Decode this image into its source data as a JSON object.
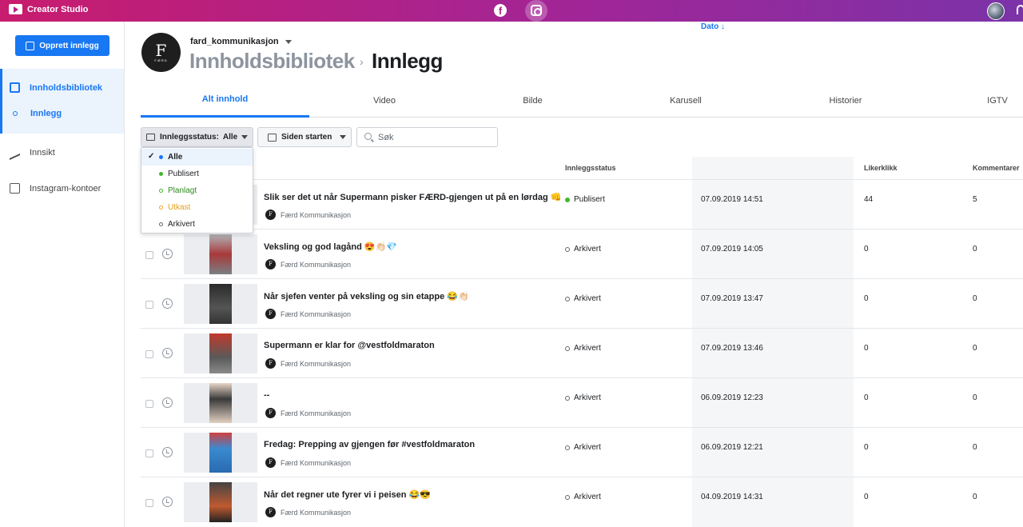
{
  "app": {
    "title": "Creator Studio"
  },
  "sidebar": {
    "create_button": "Opprett innlegg",
    "items": [
      {
        "label": "Innholdsbibliotek"
      },
      {
        "label": "Innlegg"
      },
      {
        "label": "Innsikt"
      },
      {
        "label": "Instagram-kontoer"
      }
    ]
  },
  "header": {
    "account": "fard_kommunikasjon",
    "breadcrumb": "Innholdsbibliotek",
    "separator": "›",
    "page_title": "Innlegg",
    "avatar_letter": "F",
    "avatar_text": "FÆRD"
  },
  "tabs": [
    "Alt innhold",
    "Video",
    "Bilde",
    "Karusell",
    "Historier",
    "IGTV"
  ],
  "filters": {
    "status_label": "Innleggsstatus:",
    "status_value": "Alle",
    "date_label": "Siden starten",
    "search_placeholder": "Søk",
    "options": [
      {
        "label": "Alle",
        "color": "#1877f2"
      },
      {
        "label": "Publisert",
        "color": "#42b72a"
      },
      {
        "label": "Planlagt",
        "color": "#42b72a"
      },
      {
        "label": "Utkast",
        "color": "#f5a623"
      },
      {
        "label": "Arkivert",
        "color": "#606770"
      }
    ],
    "checkmark": "✓"
  },
  "table": {
    "headers": {
      "status": "Innleggsstatus",
      "date": "Dato ↓",
      "likes": "Likerklikk",
      "comments": "Kommentarer"
    },
    "author": "Færd Kommunikasjon",
    "author_initial": "F",
    "rows": [
      {
        "title": "Slik ser det ut når Supermann pisker FÆRD-gjengen ut på en lørdag 👊",
        "status": "Publisert",
        "date": "07.09.2019 14:51",
        "likes": "44",
        "comments": "5"
      },
      {
        "title": "Veksling og god lagånd 😍👏🏻💎",
        "status": "Arkivert",
        "date": "07.09.2019 14:05",
        "likes": "0",
        "comments": "0"
      },
      {
        "title": "Når sjefen venter på veksling og sin etappe 😂👏🏻",
        "status": "Arkivert",
        "date": "07.09.2019 13:47",
        "likes": "0",
        "comments": "0"
      },
      {
        "title": "Supermann er klar for @vestfoldmaraton",
        "status": "Arkivert",
        "date": "07.09.2019 13:46",
        "likes": "0",
        "comments": "0"
      },
      {
        "title": "--",
        "status": "Arkivert",
        "date": "06.09.2019 12:23",
        "likes": "0",
        "comments": "0"
      },
      {
        "title": "Fredag: Prepping av gjengen før #vestfoldmaraton",
        "status": "Arkivert",
        "date": "06.09.2019 12:21",
        "likes": "0",
        "comments": "0"
      },
      {
        "title": "Når det regner ute fyrer vi i peisen 😂😎",
        "status": "Arkivert",
        "date": "04.09.2019 14:31",
        "likes": "0",
        "comments": "0"
      }
    ]
  }
}
